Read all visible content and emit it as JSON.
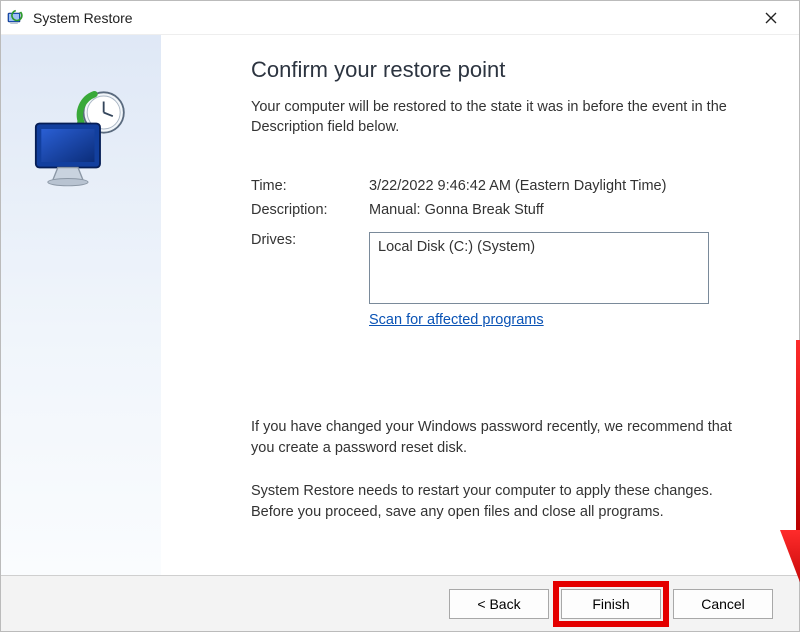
{
  "window": {
    "title": "System Restore"
  },
  "content": {
    "heading": "Confirm your restore point",
    "intro": "Your computer will be restored to the state it was in before the event in the Description field below.",
    "labels": {
      "time": "Time:",
      "description": "Description:",
      "drives": "Drives:"
    },
    "values": {
      "time": "3/22/2022 9:46:42 AM (Eastern Daylight Time)",
      "description": "Manual: Gonna Break Stuff",
      "drives_list": "Local Disk (C:) (System)"
    },
    "scan_link": "Scan for affected programs",
    "note_password": "If you have changed your Windows password recently, we recommend that you create a password reset disk.",
    "note_restart": "System Restore needs to restart your computer to apply these changes. Before you proceed, save any open files and close all programs."
  },
  "footer": {
    "back": "< Back",
    "finish": "Finish",
    "cancel": "Cancel"
  }
}
